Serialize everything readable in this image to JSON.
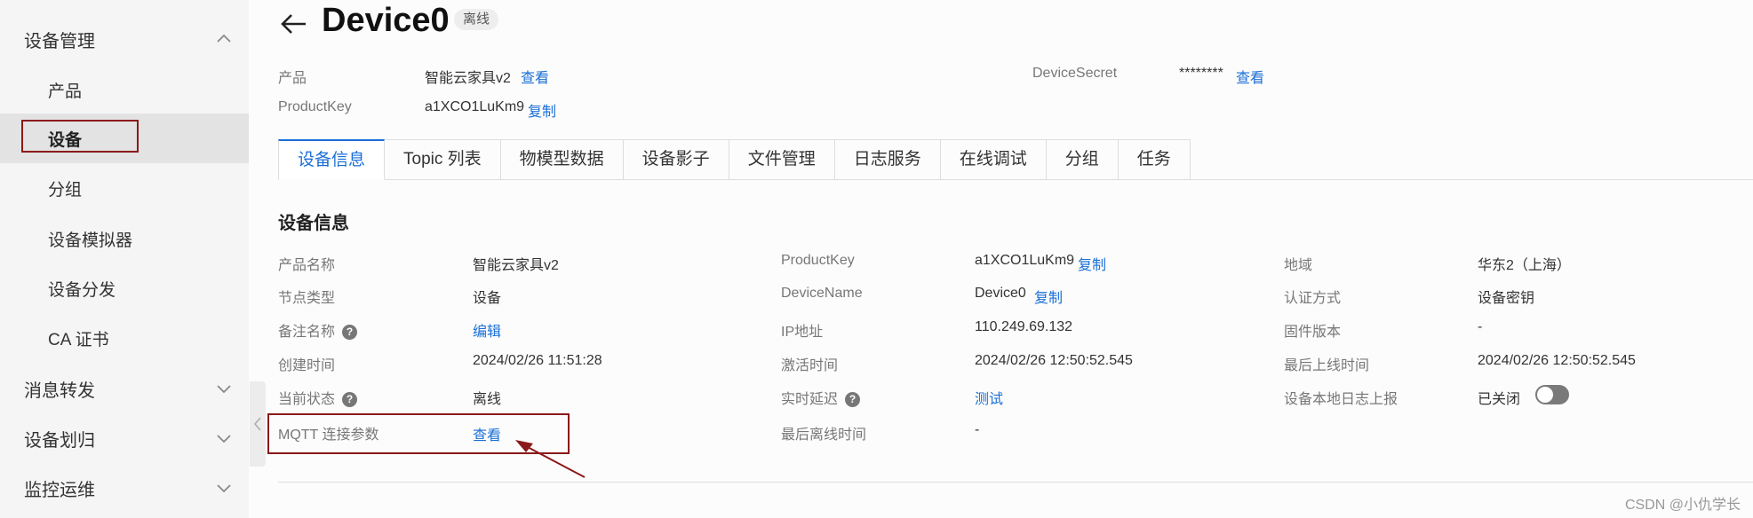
{
  "sidebar": {
    "groups": [
      {
        "label": "设备管理",
        "expanded": true
      },
      {
        "label": "消息转发",
        "expanded": false
      },
      {
        "label": "设备划归",
        "expanded": false
      },
      {
        "label": "监控运维",
        "expanded": false
      }
    ],
    "items": [
      {
        "label": "产品"
      },
      {
        "label": "设备",
        "active": true
      },
      {
        "label": "分组"
      },
      {
        "label": "设备模拟器"
      },
      {
        "label": "设备分发"
      },
      {
        "label": "CA 证书"
      }
    ]
  },
  "header": {
    "title": "Device0",
    "status_badge": "离线",
    "product_label": "产品",
    "product_value": "智能云家具v2",
    "product_link": "查看",
    "productkey_label": "ProductKey",
    "productkey_value": "a1XCO1LuKm9",
    "productkey_link": "复制",
    "devicesecret_label": "DeviceSecret",
    "devicesecret_value": "********",
    "devicesecret_link": "查看"
  },
  "tabs": [
    {
      "label": "设备信息",
      "active": true
    },
    {
      "label": "Topic 列表"
    },
    {
      "label": "物模型数据"
    },
    {
      "label": "设备影子"
    },
    {
      "label": "文件管理"
    },
    {
      "label": "日志服务"
    },
    {
      "label": "在线调试"
    },
    {
      "label": "分组"
    },
    {
      "label": "任务"
    }
  ],
  "info": {
    "section_title": "设备信息",
    "col1": [
      {
        "label": "产品名称",
        "value": "智能云家具v2"
      },
      {
        "label": "节点类型",
        "value": "设备"
      },
      {
        "label": "备注名称",
        "value": "编辑",
        "help": "?"
      },
      {
        "label": "创建时间",
        "value": "2024/02/26 11:51:28"
      },
      {
        "label": "当前状态",
        "value": "离线",
        "help": "?"
      },
      {
        "label": "MQTT 连接参数",
        "value": "查看"
      }
    ],
    "col2": [
      {
        "label": "ProductKey",
        "value": "a1XCO1LuKm9",
        "link": "复制"
      },
      {
        "label": "DeviceName",
        "value": "Device0",
        "link": "复制"
      },
      {
        "label": "IP地址",
        "value": "110.249.69.132"
      },
      {
        "label": "激活时间",
        "value": "2024/02/26 12:50:52.545"
      },
      {
        "label": "实时延迟",
        "value": "测试",
        "help": "?"
      },
      {
        "label": "最后离线时间",
        "value": "-"
      }
    ],
    "col3": [
      {
        "label": "地域",
        "value": "华东2（上海）"
      },
      {
        "label": "认证方式",
        "value": "设备密钥"
      },
      {
        "label": "固件版本",
        "value": "-"
      },
      {
        "label": "最后上线时间",
        "value": "2024/02/26 12:50:52.545"
      },
      {
        "label": "设备本地日志上报",
        "value": "已关闭",
        "toggle_on": false
      }
    ]
  },
  "watermark": "CSDN @小仇学长",
  "colors": {
    "link": "#1a6fd6",
    "annotation": "#8b1a1a"
  }
}
